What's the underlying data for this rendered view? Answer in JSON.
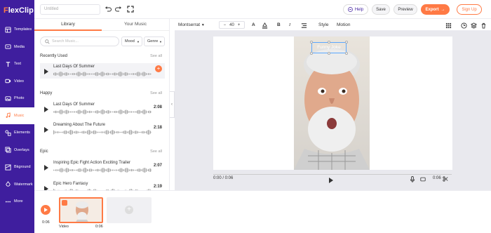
{
  "app": {
    "logo_prefix": "F",
    "logo_rest": "lexClip"
  },
  "sidebar": {
    "items": [
      {
        "label": "Templates",
        "icon": "templates-icon"
      },
      {
        "label": "Media",
        "icon": "media-icon"
      },
      {
        "label": "Text",
        "icon": "text-icon"
      },
      {
        "label": "Video",
        "icon": "video-icon"
      },
      {
        "label": "Photo",
        "icon": "photo-icon"
      },
      {
        "label": "Music",
        "icon": "music-icon",
        "active": true
      },
      {
        "label": "Elements",
        "icon": "elements-icon"
      },
      {
        "label": "Overlays",
        "icon": "overlays-icon"
      },
      {
        "label": "Bkground",
        "icon": "background-icon"
      },
      {
        "label": "Watermark",
        "icon": "watermark-icon"
      },
      {
        "label": "More",
        "icon": "more-icon"
      }
    ]
  },
  "topbar": {
    "title_placeholder": "Untitled",
    "help": "Help",
    "save": "Save",
    "preview": "Preview",
    "export": "Export",
    "signup": "Sign Up"
  },
  "panel": {
    "tabs": [
      "Library",
      "Your Music"
    ],
    "search_placeholder": "Search Music...",
    "mood": "Mood",
    "genre": "Genre",
    "see_all": "See all",
    "sections": [
      {
        "title": "Recently Used",
        "tracks": [
          {
            "name": "Last Days Of Summer",
            "duration": ""
          }
        ]
      },
      {
        "title": "Happy",
        "tracks": [
          {
            "name": "Last Days Of Summer",
            "duration": "2:08"
          },
          {
            "name": "Dreaming About The Future",
            "duration": "2:18"
          }
        ]
      },
      {
        "title": "Epic",
        "tracks": [
          {
            "name": "Inspiring Epic Fight Action Exciting Trailer",
            "duration": "2:07"
          },
          {
            "name": "Epic Hero Fantasy",
            "duration": "2:19"
          }
        ]
      }
    ]
  },
  "toolbar": {
    "font": "Montserrat",
    "font_size": "40",
    "style": "Style",
    "motion": "Motion"
  },
  "canvas": {
    "text_overlay": "Funny Joke",
    "current_time": "0:00 / 0:06",
    "end_time": "0:06"
  },
  "timeline": {
    "time": "0:06",
    "clip_label": "Video",
    "clip_duration": "0:06"
  },
  "colors": {
    "brand": "#3f1e9e",
    "accent": "#ff7a45"
  }
}
